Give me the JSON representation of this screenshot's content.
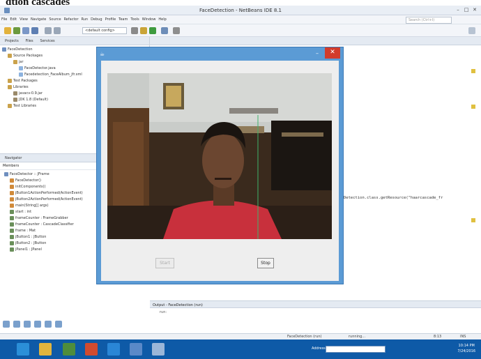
{
  "caption": "dtion cascades",
  "window": {
    "title": "FaceDetection - NetBeans IDE 8.1"
  },
  "menu": [
    "File",
    "Edit",
    "View",
    "Navigate",
    "Source",
    "Refactor",
    "Run",
    "Debug",
    "Profile",
    "Team",
    "Tools",
    "Window",
    "Help"
  ],
  "search": {
    "placeholder": "Search (Ctrl+I)"
  },
  "toolbar": {
    "config": "<default config>"
  },
  "projects": {
    "tabs": [
      "Projects",
      "Files",
      "Services"
    ],
    "tree": [
      {
        "label": "FaceDetection",
        "indent": 0,
        "color": "#6f8fbf"
      },
      {
        "label": "Source Packages",
        "indent": 1,
        "color": "#caa24b"
      },
      {
        "label": "jar",
        "indent": 2,
        "color": "#caa24b"
      },
      {
        "label": "FaceDetector.java",
        "indent": 3,
        "color": "#8db3df"
      },
      {
        "label": "Facedetection_FaceAlbum_jfr.xml",
        "indent": 3,
        "color": "#8db3df"
      },
      {
        "label": "Test Packages",
        "indent": 1,
        "color": "#caa24b"
      },
      {
        "label": "Libraries",
        "indent": 1,
        "color": "#caa24b"
      },
      {
        "label": "javacv-0.9.jar",
        "indent": 2,
        "color": "#9a8a6a"
      },
      {
        "label": "JDK 1.8 (Default)",
        "indent": 2,
        "color": "#9a8a6a"
      },
      {
        "label": "Test Libraries",
        "indent": 1,
        "color": "#caa24b"
      }
    ]
  },
  "navigator": {
    "title": "Navigator",
    "members_label": "Members",
    "items": [
      "FaceDetector :: JFrame",
      "FaceDetector()",
      "initComponents()",
      "jButton1ActionPerformed(ActionEvent)",
      "jButton2ActionPerformed(ActionEvent)",
      "main(String[] args)",
      "start : int",
      "frameCounter : FrameGrabber",
      "frameCounter : CascadeClassifier",
      "frame : Mat",
      "jButton1 : JButton",
      "jButton2 : JButton",
      "jPanel1 : JPanel"
    ]
  },
  "editor": {
    "code_fragment": "Detection.class.getResource(\"haarcascade_fr"
  },
  "output": {
    "tab": "Output - FaceDetection (run)",
    "line": "run:"
  },
  "statusbar": {
    "project": "FaceDetection (run)",
    "state": "running...",
    "position": "8:13",
    "mode": "INS"
  },
  "dialog": {
    "start_label": "Start",
    "stop_label": "Stop"
  },
  "taskbar": {
    "field_label": "Address",
    "time": "10:14 PM",
    "date": "7/24/2016"
  }
}
